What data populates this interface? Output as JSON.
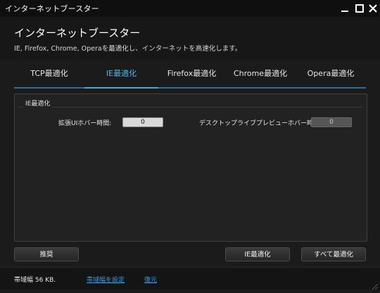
{
  "window": {
    "title": "インターネットブースター"
  },
  "header": {
    "title": "インターネットブースター",
    "subtitle": "IE, Firefox, Chrome, Operaを最適化し、インターネットを高速化します。"
  },
  "tabs": [
    {
      "label": "TCP最適化",
      "active": false
    },
    {
      "label": "IE最適化",
      "active": true
    },
    {
      "label": "Firefox最適化",
      "active": false
    },
    {
      "label": "Chrome最適化",
      "active": false
    },
    {
      "label": "Opera最適化",
      "active": false
    }
  ],
  "panel": {
    "group_label": "IE最適化",
    "ui_hover_label": "拡張UIホバー時間:",
    "ui_hover_value": "0",
    "desktop_preview_label": "デスクトップライブプレビューホバー時間:",
    "desktop_preview_value": "0"
  },
  "buttons": {
    "recommend": "推奨",
    "optimize_ie": "IE最適化",
    "optimize_all": "すべて最適化"
  },
  "status": {
    "bandwidth": "帯域幅 56 KB.",
    "set_bandwidth_link": "帯域幅を設定",
    "restore_link": "復元"
  },
  "colors": {
    "accent": "#4fb6e8",
    "link": "#3b9bd8",
    "background": "#1b1b1b"
  }
}
